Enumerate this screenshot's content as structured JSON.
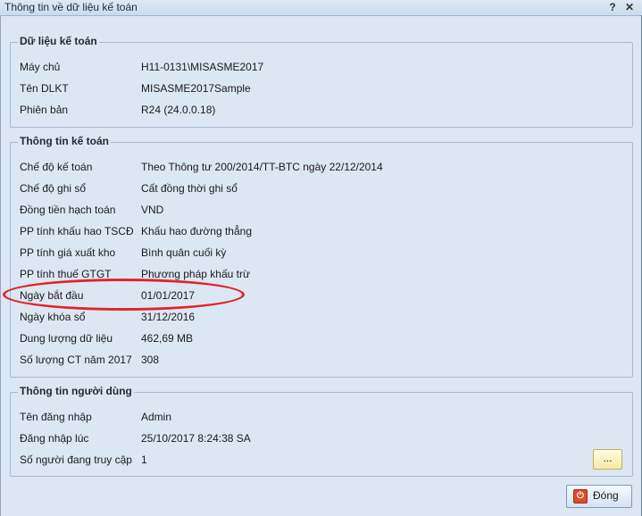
{
  "window": {
    "title": "Thông tin về dữ liệu kế toán",
    "help": "?",
    "close": "✕"
  },
  "groups": {
    "data": {
      "title": "Dữ liệu kế toán",
      "rows": [
        {
          "label": "Máy chủ",
          "value": "H11-0131\\MISASME2017"
        },
        {
          "label": "Tên DLKT",
          "value": "MISASME2017Sample"
        },
        {
          "label": "Phiên bản",
          "value": "R24 (24.0.0.18)"
        }
      ]
    },
    "accounting": {
      "title": "Thông tin kế toán",
      "rows": [
        {
          "label": "Chế độ kế toán",
          "value": "Theo Thông tư 200/2014/TT-BTC ngày 22/12/2014"
        },
        {
          "label": "Chế độ ghi sổ",
          "value": "Cất đồng thời ghi sổ"
        },
        {
          "label": "Đồng tiền hạch toán",
          "value": "VND"
        },
        {
          "label": "PP tính khấu hao TSCĐ",
          "value": "Khấu hao đường thẳng"
        },
        {
          "label": "PP tính giá xuất kho",
          "value": "Bình quân cuối kỳ"
        },
        {
          "label": "PP tính thuế GTGT",
          "value": "Phương pháp khấu trừ"
        },
        {
          "label": "Ngày bắt đầu",
          "value": "01/01/2017"
        },
        {
          "label": "Ngày khóa sổ",
          "value": "31/12/2016"
        },
        {
          "label": "Dung lượng dữ liệu",
          "value": "462,69 MB"
        },
        {
          "label": "Số lượng CT năm 2017",
          "value": "308"
        }
      ]
    },
    "user": {
      "title": "Thông tin người dùng",
      "rows": [
        {
          "label": "Tên đăng nhập",
          "value": "Admin"
        },
        {
          "label": "Đăng nhập lúc",
          "value": "25/10/2017 8:24:38 SA"
        },
        {
          "label": "Số người đang truy cập",
          "value": "1"
        }
      ],
      "more_button": "..."
    }
  },
  "footer": {
    "close_label": "Đóng",
    "close_icon": "power-icon"
  },
  "colors": {
    "highlight": "#e0252a",
    "accent": "#e04a2d"
  }
}
